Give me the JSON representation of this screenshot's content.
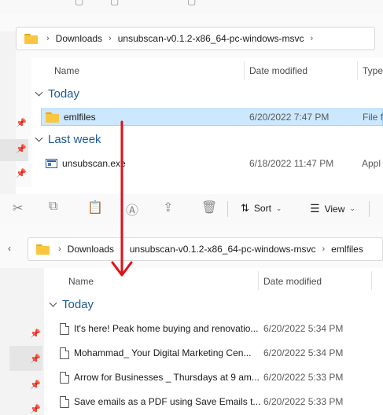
{
  "top_window": {
    "breadcrumb": [
      "Downloads",
      "unsubscan-v0.1.2-x86_64-pc-windows-msvc"
    ],
    "columns": [
      "Name",
      "Date modified",
      "Type"
    ],
    "groups": [
      {
        "label": "Today",
        "rows": [
          {
            "name": "emlfiles",
            "date": "6/20/2022 7:47 PM",
            "type": "File f",
            "icon": "folder-icon",
            "selected": true
          }
        ]
      },
      {
        "label": "Last week",
        "rows": [
          {
            "name": "unsubscan.exe",
            "date": "6/18/2022 11:47 PM",
            "type": "Appl",
            "icon": "exe-icon",
            "selected": false
          }
        ]
      }
    ]
  },
  "bottom_window": {
    "toolbar": {
      "sort_label": "Sort",
      "view_label": "View"
    },
    "breadcrumb": [
      "Downloads",
      "unsubscan-v0.1.2-x86_64-pc-windows-msvc",
      "emlfiles"
    ],
    "columns": [
      "Name",
      "Date modified"
    ],
    "group_label": "Today",
    "rows": [
      {
        "name": "It's here! Peak home buying and renovatio...",
        "date": "6/20/2022 5:34 PM"
      },
      {
        "name": "Mohammad_ Your Digital Marketing Cen...",
        "date": "6/20/2022 5:34 PM"
      },
      {
        "name": "Arrow for Businesses _ Thursdays at 9 am...",
        "date": "6/20/2022 5:33 PM"
      },
      {
        "name": "Save emails as a PDF using Save Emails t...",
        "date": "6/20/2022 5:33 PM"
      }
    ]
  },
  "annotation": {
    "arrow_color": "#e0101a"
  },
  "colors": {
    "accent_group": "#1e5a9a",
    "selection": "#cce8ff"
  }
}
